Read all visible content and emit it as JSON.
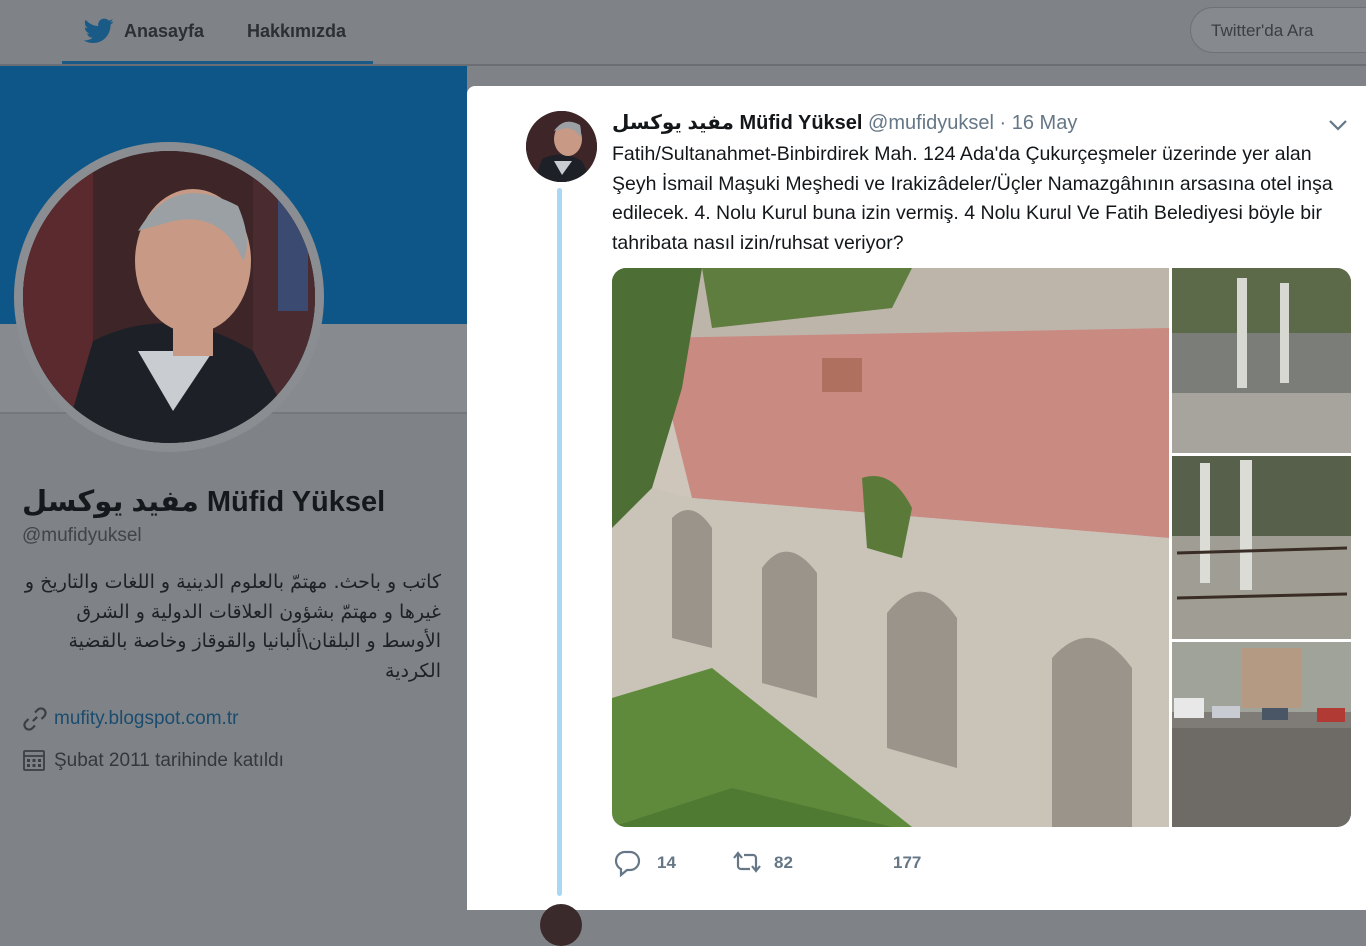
{
  "nav": {
    "home_label": "Anasayfa",
    "about_label": "Hakkımızda",
    "search_placeholder": "Twitter'da Ara"
  },
  "profile": {
    "name": "مفيد يوكسل Müfid Yüksel",
    "handle": "@mufidyuksel",
    "bio": "كاتب و باحث. مهتمّ بالعلوم الدينية و اللغات والتاريخ و غيرها و مهتمّ بشؤون العلاقات الدولية و الشرق الأوسط و البلقان\\ألبانيا والقوقاز وخاصة بالقضية الكردية",
    "url": "mufity.blogspot.com.tr",
    "joined": "Şubat 2011 tarihinde katıldı"
  },
  "tweet": {
    "author_name": "مفيد يوكسل Müfid Yüksel",
    "author_handle": "@mufidyuksel",
    "separator": "·",
    "date": "16 May",
    "text": "Fatih/Sultanahmet-Binbirdirek Mah. 124 Ada'da Çukurçeşmeler üzerinde yer alan Şeyh İsmail Maşuki Meşhedi ve Irakizâdeler/Üçler Namazgâhının arsasına otel inşa edilecek. 4. Nolu Kurul buna izin vermiş. 4 Nolu Kurul Ve Fatih Belediyesi böyle bir tahribata nasıl izin/ruhsat veriyor?",
    "replies": "14",
    "retweets": "82",
    "likes": "177"
  },
  "colors": {
    "brand": "#1da1f2",
    "banner": "#0e5688",
    "overlay_gray": "#7f8387",
    "thread_line": "#a8d8f6",
    "link": "#1a4c70"
  },
  "icons": {
    "nav_home": "twitter-bird-icon",
    "search": "none",
    "url": "link-icon",
    "joined": "calendar-icon",
    "menu": "chevron-down-icon",
    "reply": "reply-icon",
    "retweet": "retweet-icon",
    "like": "heart-icon"
  }
}
